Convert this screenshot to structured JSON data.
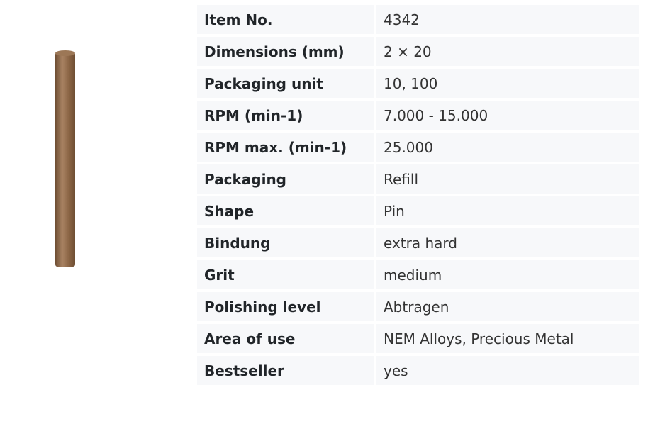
{
  "product": {
    "image_alt": "Brown polishing pin",
    "colors": {
      "pin_body": "#8a6444",
      "pin_highlight": "#a88262",
      "pin_shadow": "#6e4e33"
    }
  },
  "specs": [
    {
      "label": "Item No.",
      "value": "4342"
    },
    {
      "label": "Dimensions (mm)",
      "value": "2 × 20"
    },
    {
      "label": "Packaging unit",
      "value": "10, 100"
    },
    {
      "label": "RPM (min-1)",
      "value": "7.000 - 15.000"
    },
    {
      "label": "RPM max. (min-1)",
      "value": "25.000"
    },
    {
      "label": "Packaging",
      "value": "Refill"
    },
    {
      "label": "Shape",
      "value": "Pin"
    },
    {
      "label": "Bindung",
      "value": "extra hard"
    },
    {
      "label": "Grit",
      "value": "medium"
    },
    {
      "label": "Polishing level",
      "value": "Abtragen"
    },
    {
      "label": "Area of use",
      "value": "NEM Alloys, Precious Metal"
    },
    {
      "label": "Bestseller",
      "value": "yes"
    }
  ]
}
